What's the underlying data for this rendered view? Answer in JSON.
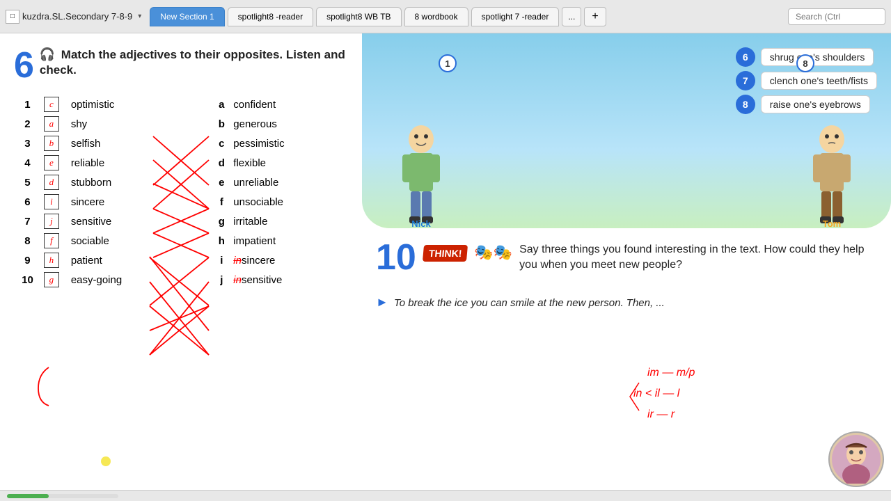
{
  "topbar": {
    "window_icon": "□",
    "app_title": "kuzdra.SL.Secondary 7-8-9",
    "tabs": [
      {
        "label": "New Section 1",
        "active": true,
        "type": "new"
      },
      {
        "label": "spotlight8 -reader",
        "active": false,
        "type": "normal"
      },
      {
        "label": "spotlight8 WB TB",
        "active": false,
        "type": "normal"
      },
      {
        "label": "8 wordbook",
        "active": false,
        "type": "normal"
      },
      {
        "label": "spotlight 7 -reader",
        "active": false,
        "type": "normal"
      }
    ],
    "tab_more": "...",
    "tab_add": "+",
    "search_placeholder": "Search (Ctrl"
  },
  "exercise6": {
    "number": "6",
    "instruction": "Match the adjectives to their opposites. Listen and check.",
    "rows": [
      {
        "num": "1",
        "answer": "c",
        "left": "optimistic",
        "letter": "a",
        "right": "confident"
      },
      {
        "num": "2",
        "answer": "a",
        "left": "shy",
        "letter": "b",
        "right": "generous"
      },
      {
        "num": "3",
        "answer": "b",
        "left": "selfish",
        "letter": "c",
        "right": "pessimistic"
      },
      {
        "num": "4",
        "answer": "e",
        "left": "reliable",
        "letter": "d",
        "right": "flexible"
      },
      {
        "num": "5",
        "answer": "d",
        "left": "stubborn",
        "letter": "e",
        "right": "unreliable"
      },
      {
        "num": "6",
        "answer": "i",
        "left": "sincere",
        "letter": "f",
        "right": "unsociable"
      },
      {
        "num": "7",
        "answer": "j",
        "left": "sensitive",
        "letter": "g",
        "right": "irritable"
      },
      {
        "num": "8",
        "answer": "f",
        "left": "sociable",
        "letter": "h",
        "right": "impatient"
      },
      {
        "num": "9",
        "answer": "h",
        "left": "patient",
        "letter": "i",
        "right": "insincere"
      },
      {
        "num": "10",
        "answer": "g",
        "left": "easy-going",
        "letter": "j",
        "right": "insensitive"
      }
    ]
  },
  "phrases": [
    {
      "num": "6",
      "text": "shrug one's shoulders"
    },
    {
      "num": "7",
      "text": "clench one's teeth/fists"
    },
    {
      "num": "8",
      "text": "raise one's eyebrows"
    }
  ],
  "characters": {
    "nick_label": "Nick",
    "tom_label": "Tom"
  },
  "exercise10": {
    "number": "10",
    "think_label": "THINK!",
    "text": "Say three things you found interesting in the text. How could they help you when you meet new people?",
    "prompt": "To break the ice you can smile at the new person. Then, ..."
  },
  "handwriting": {
    "line1": "im — m/p",
    "line2": "in < il — l",
    "line3": "ir — r"
  },
  "status": {
    "progress_label": ""
  }
}
